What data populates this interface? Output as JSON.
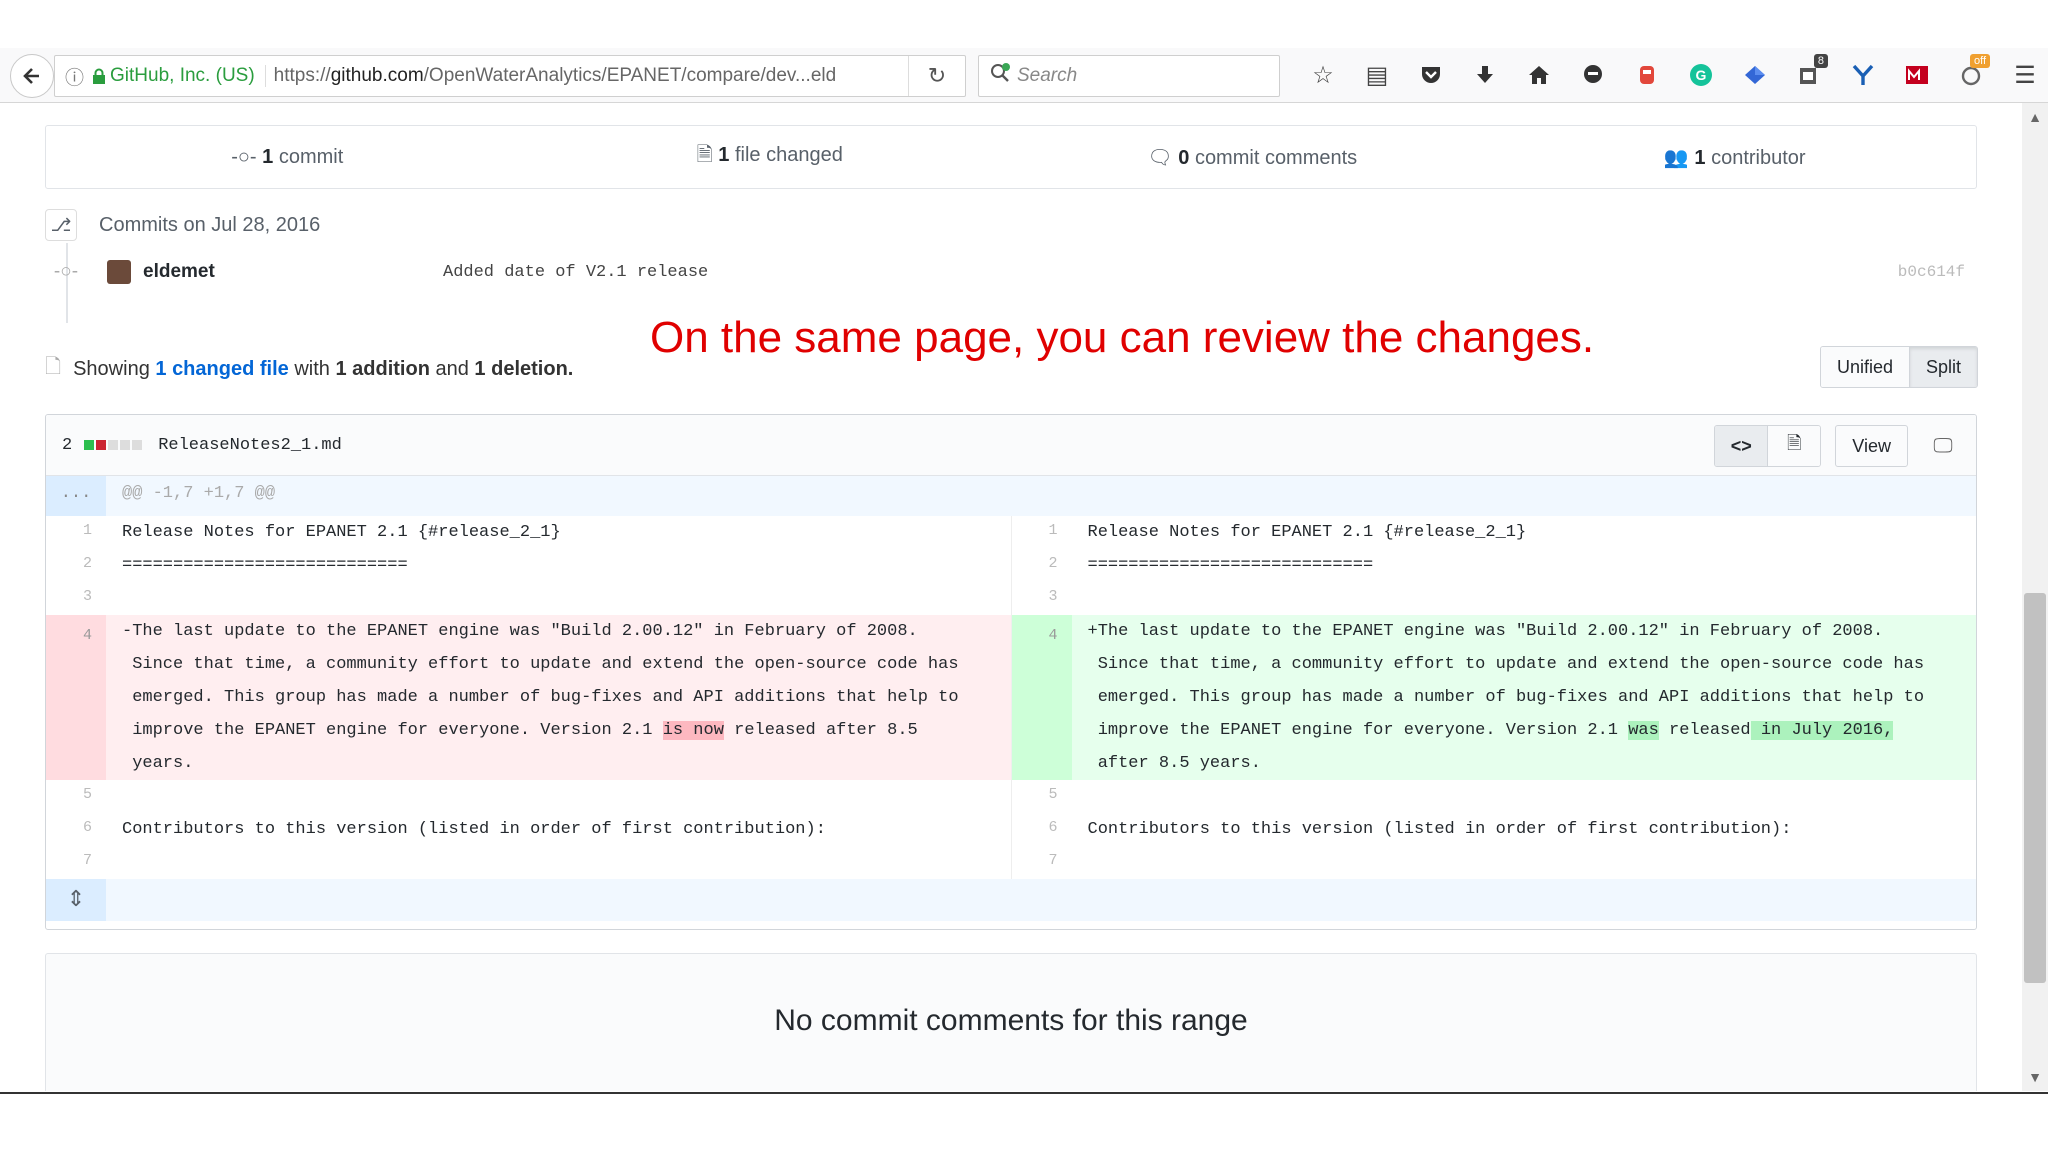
{
  "browser": {
    "identity_org": "GitHub, Inc. (US)",
    "url_prefix": "https://",
    "url_domain": "github.com",
    "url_path": "/OpenWaterAnalytics/EPANET/compare/dev...eld",
    "search_placeholder": "Search",
    "toolbar_icons": [
      "bookmark-star-icon",
      "reading-list-icon",
      "pocket-icon",
      "download-icon",
      "home-icon",
      "chat-icon",
      "extension-red-icon",
      "grammarly-icon",
      "extension-blue-icon",
      "extension-badge-icon",
      "extension-y-icon",
      "extension-mail-icon",
      "extension-off-icon",
      "menu-icon"
    ],
    "badge_count": "8",
    "badge_off": "off"
  },
  "summary": {
    "commits_count": "1",
    "commits_label": "commit",
    "files_count": "1",
    "files_label": "file changed",
    "comments_count": "0",
    "comments_label": "commit comments",
    "contributors_count": "1",
    "contributors_label": "contributor"
  },
  "commits": {
    "heading": "Commits on Jul 28, 2016",
    "items": [
      {
        "author": "eldemet",
        "message": "Added date of V2.1 release",
        "sha": "b0c614f"
      }
    ]
  },
  "annotation": "On the same page, you can review the changes.",
  "showing": {
    "prefix": "Showing",
    "changed_count": "1",
    "changed_label": "changed file",
    "with": "with",
    "additions_count": "1",
    "additions_label": "addition",
    "and": "and",
    "deletions_count": "1",
    "deletions_label": "deletion."
  },
  "view_toggle": {
    "unified": "Unified",
    "split": "Split",
    "active": "Split"
  },
  "file": {
    "change_count": "2",
    "filename": "ReleaseNotes2_1.md",
    "view_label": "View",
    "hunk_dots": "...",
    "hunk_header": "@@ -1,7 +1,7 @@",
    "colors": {
      "deletion": "#ffeef0",
      "addition": "#e6ffed"
    }
  },
  "diff": {
    "left": {
      "l1": "1",
      "c1": "Release Notes for EPANET 2.1 {#release_2_1}",
      "l2": "2",
      "c2": "============================",
      "l3": "3",
      "l4": "4",
      "d1": "-The last update to the EPANET engine was \"Build 2.00.12\" in February of 2008.",
      "d2": " Since that time, a community effort to update and extend the open-source code has",
      "d3": " emerged. This group has made a number of bug-fixes and API additions that help to",
      "d4a": " improve the EPANET engine for everyone. Version 2.1 ",
      "d4h": "is now",
      "d4b": " released after 8.5",
      "d5": " years.",
      "l5": "5",
      "l6": "6",
      "c6": "Contributors to this version (listed in order of first contribution):",
      "l7": "7"
    },
    "right": {
      "l1": "1",
      "c1": "Release Notes for EPANET 2.1 {#release_2_1}",
      "l2": "2",
      "c2": "============================",
      "l3": "3",
      "l4": "4",
      "a1": "+The last update to the EPANET engine was \"Build 2.00.12\" in February of 2008.",
      "a2": " Since that time, a community effort to update and extend the open-source code has",
      "a3": " emerged. This group has made a number of bug-fixes and API additions that help to",
      "a4a": " improve the EPANET engine for everyone. Version 2.1 ",
      "a4h1": "was",
      "a4m": " released",
      "a4h2": " in July 2016,",
      "a5": " after 8.5 years.",
      "l5": "5",
      "l6": "6",
      "c6": "Contributors to this version (listed in order of first contribution):",
      "l7": "7"
    }
  },
  "no_comments": "No commit comments for this range"
}
